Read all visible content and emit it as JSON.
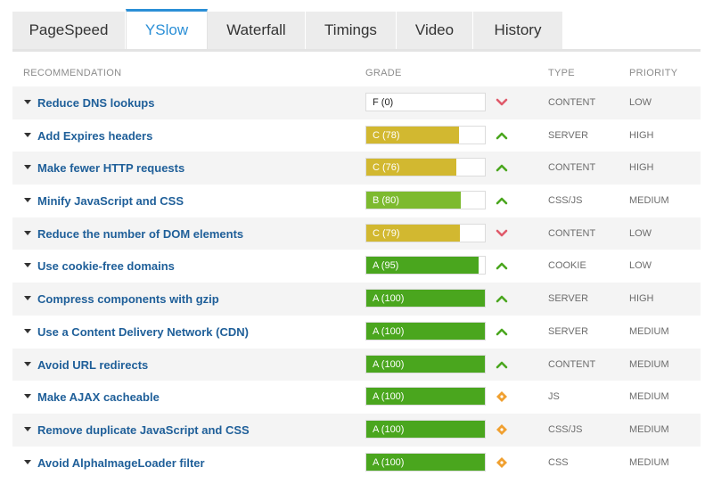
{
  "tabs": [
    {
      "label": "PageSpeed",
      "active": false
    },
    {
      "label": "YSlow",
      "active": true
    },
    {
      "label": "Waterfall",
      "active": false
    },
    {
      "label": "Timings",
      "active": false
    },
    {
      "label": "Video",
      "active": false
    },
    {
      "label": "History",
      "active": false
    }
  ],
  "table": {
    "headers": {
      "recommendation": "RECOMMENDATION",
      "grade": "GRADE",
      "type": "TYPE",
      "priority": "PRIORITY"
    },
    "rows": [
      {
        "recommendation": "Reduce DNS lookups",
        "grade": "F (0)",
        "score": 0,
        "color": "#ffffff",
        "trend": "down",
        "type": "CONTENT",
        "priority": "LOW"
      },
      {
        "recommendation": "Add Expires headers",
        "grade": "C (78)",
        "score": 78,
        "color": "#d2b830",
        "trend": "up",
        "type": "SERVER",
        "priority": "HIGH"
      },
      {
        "recommendation": "Make fewer HTTP requests",
        "grade": "C (76)",
        "score": 76,
        "color": "#d2b830",
        "trend": "up",
        "type": "CONTENT",
        "priority": "HIGH"
      },
      {
        "recommendation": "Minify JavaScript and CSS",
        "grade": "B (80)",
        "score": 80,
        "color": "#7dba2f",
        "trend": "up",
        "type": "CSS/JS",
        "priority": "MEDIUM"
      },
      {
        "recommendation": "Reduce the number of DOM elements",
        "grade": "C (79)",
        "score": 79,
        "color": "#d2b830",
        "trend": "down",
        "type": "CONTENT",
        "priority": "LOW"
      },
      {
        "recommendation": "Use cookie-free domains",
        "grade": "A (95)",
        "score": 95,
        "color": "#4aa61e",
        "trend": "up",
        "type": "COOKIE",
        "priority": "LOW"
      },
      {
        "recommendation": "Compress components with gzip",
        "grade": "A (100)",
        "score": 100,
        "color": "#4aa61e",
        "trend": "up",
        "type": "SERVER",
        "priority": "HIGH"
      },
      {
        "recommendation": "Use a Content Delivery Network (CDN)",
        "grade": "A (100)",
        "score": 100,
        "color": "#4aa61e",
        "trend": "up",
        "type": "SERVER",
        "priority": "MEDIUM"
      },
      {
        "recommendation": "Avoid URL redirects",
        "grade": "A (100)",
        "score": 100,
        "color": "#4aa61e",
        "trend": "up",
        "type": "CONTENT",
        "priority": "MEDIUM"
      },
      {
        "recommendation": "Make AJAX cacheable",
        "grade": "A (100)",
        "score": 100,
        "color": "#4aa61e",
        "trend": "neutral",
        "type": "JS",
        "priority": "MEDIUM"
      },
      {
        "recommendation": "Remove duplicate JavaScript and CSS",
        "grade": "A (100)",
        "score": 100,
        "color": "#4aa61e",
        "trend": "neutral",
        "type": "CSS/JS",
        "priority": "MEDIUM"
      },
      {
        "recommendation": "Avoid AlphaImageLoader filter",
        "grade": "A (100)",
        "score": 100,
        "color": "#4aa61e",
        "trend": "neutral",
        "type": "CSS",
        "priority": "MEDIUM"
      }
    ]
  },
  "trend_icons": {
    "up": "chevron-up-icon",
    "down": "chevron-down-icon",
    "neutral": "diamond-icon"
  },
  "trend_colors": {
    "up": "#4aa61e",
    "down": "#e05a6a",
    "neutral": "#f0a030"
  }
}
